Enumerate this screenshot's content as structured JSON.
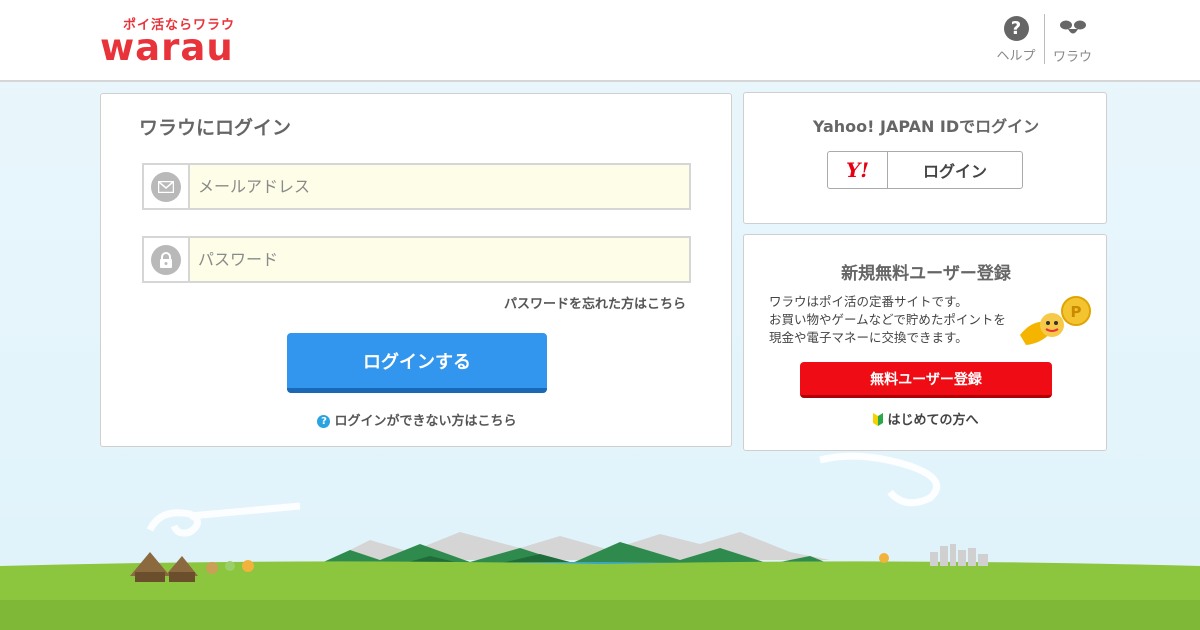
{
  "header": {
    "logo_tagline": "ポイ活ならワラウ",
    "logo_word": "warau",
    "nav": [
      {
        "label": "ヘルプ",
        "icon": "help-icon"
      },
      {
        "label": "ワラウ",
        "icon": "warau-mascot-icon"
      }
    ]
  },
  "login": {
    "title": "ワラウにログイン",
    "email_placeholder": "メールアドレス",
    "password_placeholder": "パスワード",
    "forgot_link": "パスワードを忘れた方はこちら",
    "submit_label": "ログインする",
    "cant_login_link": "ログインができない方はこちら"
  },
  "yahoo": {
    "title": "Yahoo! JAPAN IDでログイン",
    "logo_text": "Y!",
    "button_label": "ログイン"
  },
  "register": {
    "title": "新規無料ユーザー登録",
    "desc_lines": [
      "ワラウはポイ活の定番サイトです。",
      "お買い物やゲームなどで貯めたポイントを",
      "現金や電子マネーに交換できます。"
    ],
    "button_label": "無料ユーザー登録",
    "first_time_link": "はじめての方へ"
  },
  "colors": {
    "brand_red": "#e8333a",
    "login_blue": "#3396ee",
    "register_red": "#f00c14",
    "grass_green": "#8cc63f"
  }
}
